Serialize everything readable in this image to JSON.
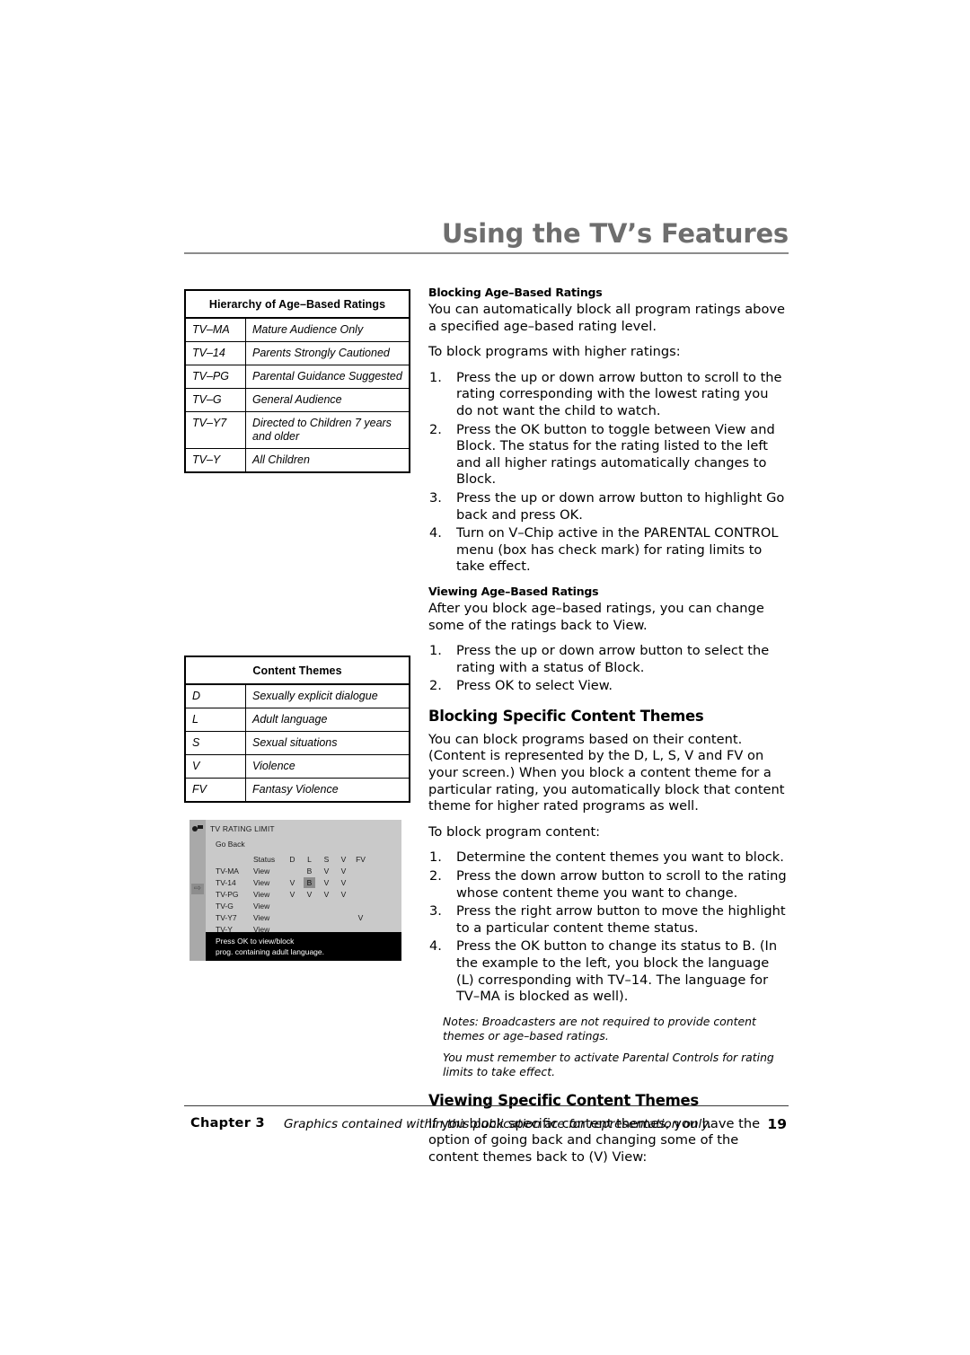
{
  "header": {
    "title": "Using the TV’s Features"
  },
  "hierarchy_table": {
    "caption": "Hierarchy of Age–Based Ratings",
    "rows": [
      {
        "code": "TV–MA",
        "desc": "Mature Audience Only"
      },
      {
        "code": "TV–14",
        "desc": "Parents Strongly Cautioned"
      },
      {
        "code": "TV–PG",
        "desc": "Parental Guidance Suggested"
      },
      {
        "code": "TV–G",
        "desc": "General Audience"
      },
      {
        "code": "TV–Y7",
        "desc": "Directed to Children 7 years and older"
      },
      {
        "code": "TV–Y",
        "desc": "All Children"
      }
    ]
  },
  "content_themes_table": {
    "caption": "Content Themes",
    "rows": [
      {
        "code": "D",
        "desc": "Sexually explicit dialogue"
      },
      {
        "code": "L",
        "desc": "Adult language"
      },
      {
        "code": "S",
        "desc": "Sexual situations"
      },
      {
        "code": "V",
        "desc": "Violence"
      },
      {
        "code": "FV",
        "desc": "Fantasy Violence"
      }
    ]
  },
  "tv_screen": {
    "title": "TV RATING LIMIT",
    "go_back": "Go Back",
    "column_headers": {
      "status": "Status",
      "d": "D",
      "l": "L",
      "s": "S",
      "v": "V",
      "fv": "FV"
    },
    "rows": [
      {
        "label": "TV-MA",
        "status": "View",
        "d": "",
        "l": "B",
        "s": "V",
        "v": "V",
        "fv": "",
        "highlight": ""
      },
      {
        "label": "TV-14",
        "status": "View",
        "d": "V",
        "l": "B",
        "s": "V",
        "v": "V",
        "fv": "",
        "highlight": "l"
      },
      {
        "label": "TV-PG",
        "status": "View",
        "d": "V",
        "l": "V",
        "s": "V",
        "v": "V",
        "fv": "",
        "highlight": ""
      },
      {
        "label": "TV-G",
        "status": "View",
        "d": "",
        "l": "",
        "s": "",
        "v": "",
        "fv": "",
        "highlight": ""
      },
      {
        "label": "TV-Y7",
        "status": "View",
        "d": "",
        "l": "",
        "s": "",
        "v": "",
        "fv": "V",
        "highlight": ""
      },
      {
        "label": "TV-Y",
        "status": "View",
        "d": "",
        "l": "",
        "s": "",
        "v": "",
        "fv": "",
        "highlight": ""
      }
    ],
    "message_line1": "Press OK to view/block",
    "message_line2": "prog. containing adult language."
  },
  "right_column": {
    "blocking_age": {
      "heading": "Blocking Age–Based Ratings",
      "intro": "You can automatically block all program ratings above a specified age–based rating level.",
      "lead": "To block programs with higher ratings:",
      "steps": [
        "Press the up or down arrow button to scroll to the rating corresponding with the lowest rating you do not want the child to watch.",
        "Press the OK button to toggle between View and Block. The status for the rating listed to the left and all higher ratings automatically changes to Block.",
        "Press the up or down arrow button to highlight Go back and press OK.",
        "Turn on V–Chip active in the PARENTAL CONTROL menu (box has check mark) for rating limits to take effect."
      ]
    },
    "viewing_age": {
      "heading": "Viewing Age–Based Ratings",
      "intro": "After you block age–based ratings, you can change some of the ratings back to View.",
      "steps": [
        "Press the up or down arrow button to select the rating with a status of Block.",
        "Press OK to select View."
      ]
    },
    "blocking_themes": {
      "heading": "Blocking Specific Content Themes",
      "intro": "You can block programs based on their content. (Content is represented by the D, L, S, V and FV on your screen.) When you block a content theme for a particular rating, you automatically block that content theme for higher rated programs as well.",
      "lead": "To block program content:",
      "steps": [
        "Determine the content themes you want to block.",
        "Press the down arrow button to scroll to the rating whose content theme you want to change.",
        "Press the right arrow button to move the highlight to a particular content theme status.",
        "Press the OK button to change its status to B. (In the example to the left, you block the language (L) corresponding with TV–14. The language for TV–MA is blocked as well)."
      ],
      "note1": "Notes: Broadcasters are not required to provide content themes or age–based ratings.",
      "note2": "You must remember to activate Parental Controls for rating limits to take effect."
    },
    "viewing_themes": {
      "heading": "Viewing Specific Content Themes",
      "intro": "If you block specific content themes, you have the option of going back and changing some of the content themes back to (V) View:"
    }
  },
  "step_numbers": [
    "1.",
    "2.",
    "3.",
    "4."
  ],
  "footer": {
    "chapter": "Chapter 3",
    "note": "Graphics contained within this publication are for representation only.",
    "page": "19"
  }
}
